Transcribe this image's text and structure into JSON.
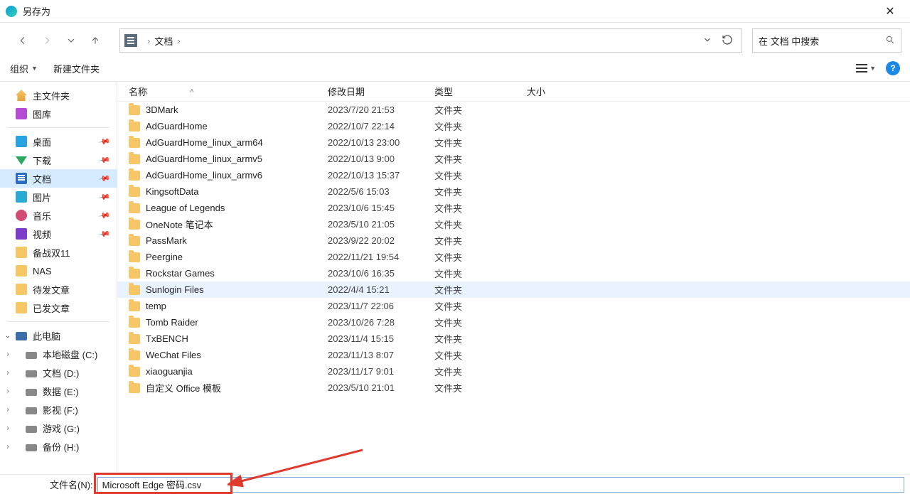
{
  "window": {
    "title": "另存为"
  },
  "crumbs": {
    "segment": "文档",
    "sep": "›"
  },
  "search": {
    "placeholder": "在 文档 中搜索"
  },
  "toolbar": {
    "organize": "组织",
    "newfolder": "新建文件夹"
  },
  "columns": {
    "name": "名称",
    "date": "修改日期",
    "type": "类型",
    "size": "大小"
  },
  "sidebar_top": [
    {
      "icon": "ic-home",
      "label": "主文件夹"
    },
    {
      "icon": "ic-gallery",
      "label": "图库"
    }
  ],
  "sidebar_pinned": [
    {
      "icon": "ic-desktop",
      "label": "桌面",
      "pin": true
    },
    {
      "icon": "ic-download",
      "label": "下载",
      "pin": true
    },
    {
      "icon": "ic-docs",
      "label": "文档",
      "pin": true,
      "selected": true
    },
    {
      "icon": "ic-pics",
      "label": "图片",
      "pin": true
    },
    {
      "icon": "ic-music",
      "label": "音乐",
      "pin": true
    },
    {
      "icon": "ic-video",
      "label": "视频",
      "pin": true
    },
    {
      "icon": "ic-folder",
      "label": "备战双11"
    },
    {
      "icon": "ic-folder",
      "label": "NAS"
    },
    {
      "icon": "ic-folder",
      "label": "待发文章"
    },
    {
      "icon": "ic-folder",
      "label": "已发文章"
    }
  ],
  "sidebar_pc": {
    "label": "此电脑"
  },
  "sidebar_drives": [
    {
      "label": "本地磁盘 (C:)"
    },
    {
      "label": "文档 (D:)"
    },
    {
      "label": "数据 (E:)"
    },
    {
      "label": "影视 (F:)"
    },
    {
      "label": "游戏 (G:)"
    },
    {
      "label": "备份 (H:)"
    }
  ],
  "files": [
    {
      "name": "3DMark",
      "date": "2023/7/20 21:53",
      "type": "文件夹"
    },
    {
      "name": "AdGuardHome",
      "date": "2022/10/7 22:14",
      "type": "文件夹"
    },
    {
      "name": "AdGuardHome_linux_arm64",
      "date": "2022/10/13 23:00",
      "type": "文件夹"
    },
    {
      "name": "AdGuardHome_linux_armv5",
      "date": "2022/10/13 9:00",
      "type": "文件夹"
    },
    {
      "name": "AdGuardHome_linux_armv6",
      "date": "2022/10/13 15:37",
      "type": "文件夹"
    },
    {
      "name": "KingsoftData",
      "date": "2022/5/6 15:03",
      "type": "文件夹"
    },
    {
      "name": "League of Legends",
      "date": "2023/10/6 15:45",
      "type": "文件夹"
    },
    {
      "name": "OneNote 笔记本",
      "date": "2023/5/10 21:05",
      "type": "文件夹"
    },
    {
      "name": "PassMark",
      "date": "2023/9/22 20:02",
      "type": "文件夹"
    },
    {
      "name": "Peergine",
      "date": "2022/11/21 19:54",
      "type": "文件夹"
    },
    {
      "name": "Rockstar Games",
      "date": "2023/10/6 16:35",
      "type": "文件夹"
    },
    {
      "name": "Sunlogin Files",
      "date": "2022/4/4 15:21",
      "type": "文件夹",
      "hover": true
    },
    {
      "name": "temp",
      "date": "2023/11/7 22:06",
      "type": "文件夹"
    },
    {
      "name": "Tomb Raider",
      "date": "2023/10/26 7:28",
      "type": "文件夹"
    },
    {
      "name": "TxBENCH",
      "date": "2023/11/4 15:15",
      "type": "文件夹"
    },
    {
      "name": "WeChat Files",
      "date": "2023/11/13 8:07",
      "type": "文件夹"
    },
    {
      "name": "xiaoguanjia",
      "date": "2023/11/17 9:01",
      "type": "文件夹"
    },
    {
      "name": "自定义 Office 模板",
      "date": "2023/5/10 21:01",
      "type": "文件夹"
    }
  ],
  "bottom": {
    "label": "文件名(N):",
    "value": "Microsoft Edge 密码.csv"
  }
}
